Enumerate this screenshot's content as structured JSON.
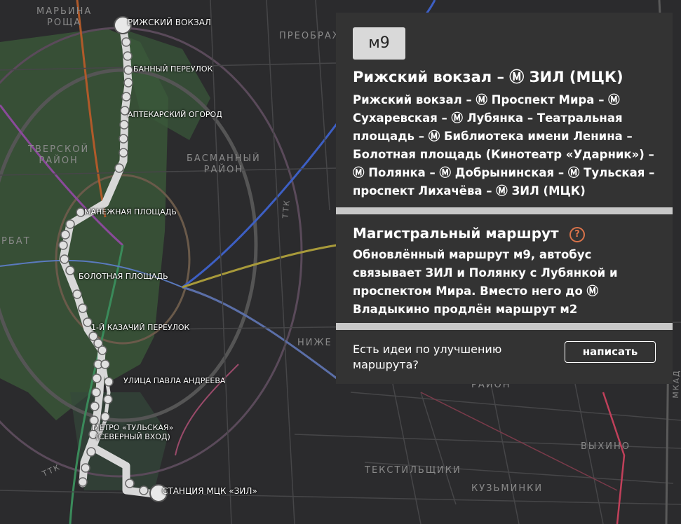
{
  "map": {
    "districts": [
      {
        "id": "marina",
        "text": "МАРЬИНА\nРОЩА"
      },
      {
        "id": "tver",
        "text": "ТВЕРСКОЙ\nРАЙОН"
      },
      {
        "id": "basman",
        "text": "БАСМАННЫЙ\nРАЙОН"
      },
      {
        "id": "preobr",
        "text": "ПРЕОБРАЖ"
      },
      {
        "id": "arbat",
        "text": "РБАТ"
      },
      {
        "id": "nizhe",
        "text": "НИЖЕ"
      },
      {
        "id": "rayon2",
        "text": "РАЙОН"
      },
      {
        "id": "tekst",
        "text": "ТЕКСТИЛЬЩИКИ"
      },
      {
        "id": "kuzm",
        "text": "КУЗЬМИНКИ"
      },
      {
        "id": "vyhino",
        "text": "ВЫХИНО"
      },
      {
        "id": "ttk1",
        "text": "ТТК"
      },
      {
        "id": "ttk2",
        "text": "ТТК"
      },
      {
        "id": "mkad",
        "text": "МКАД"
      }
    ],
    "stops": [
      {
        "id": "rizh",
        "text": "РИЖСКИЙ ВОКЗАЛ"
      },
      {
        "id": "bann",
        "text": "БАННЫЙ ПЕРЕУЛОК"
      },
      {
        "id": "apt",
        "text": "АПТЕКАРСКИЙ ОГОРОД"
      },
      {
        "id": "man",
        "text": "МАНЕЖНАЯ ПЛОЩАДЬ"
      },
      {
        "id": "bol",
        "text": "БОЛОТНАЯ ПЛОЩАДЬ"
      },
      {
        "id": "kaz",
        "text": "1-Й КАЗАЧИЙ ПЕРЕУЛОК"
      },
      {
        "id": "pavl",
        "text": "УЛИЦА ПАВЛА АНДРЕЕВА"
      },
      {
        "id": "tul",
        "text": "МЕТРО «ТУЛЬСКАЯ»\n(СЕВЕРНЫЙ ВХОД)"
      },
      {
        "id": "zil",
        "text": "СТАНЦИЯ МЦК «ЗИЛ»"
      }
    ],
    "colors": {
      "route": "#d8d8d8",
      "park": "#3c5a3c",
      "background": "#2b2b2d"
    }
  },
  "panel": {
    "badge": "м9",
    "title": "Рижский вокзал – Ⓜ ЗИЛ (МЦК)",
    "stops": "Рижский вокзал – Ⓜ Проспект Мира – Ⓜ Сухаревская – Ⓜ Лубянка – Театральная площадь – Ⓜ Библиотека имени Ленина – Болотная площадь (Кинотеатр «Ударник») – Ⓜ Полянка – Ⓜ Добрынинская – Ⓜ Тульская – проспект Лихачёва – Ⓜ ЗИЛ (МЦК)",
    "main_title": "Магистральный маршрут",
    "help_icon": "question-circle-icon",
    "main_text": "Обновлённый маршрут м9, автобус связывает ЗИЛ и Полянку с Лубянкой и проспектом Мира. Вместо него до Ⓜ Владыкино продлён маршрут м2",
    "ideas": "Есть идеи по улучшению маршрута?",
    "write_button": "написать",
    "accent": "#d9734a"
  }
}
